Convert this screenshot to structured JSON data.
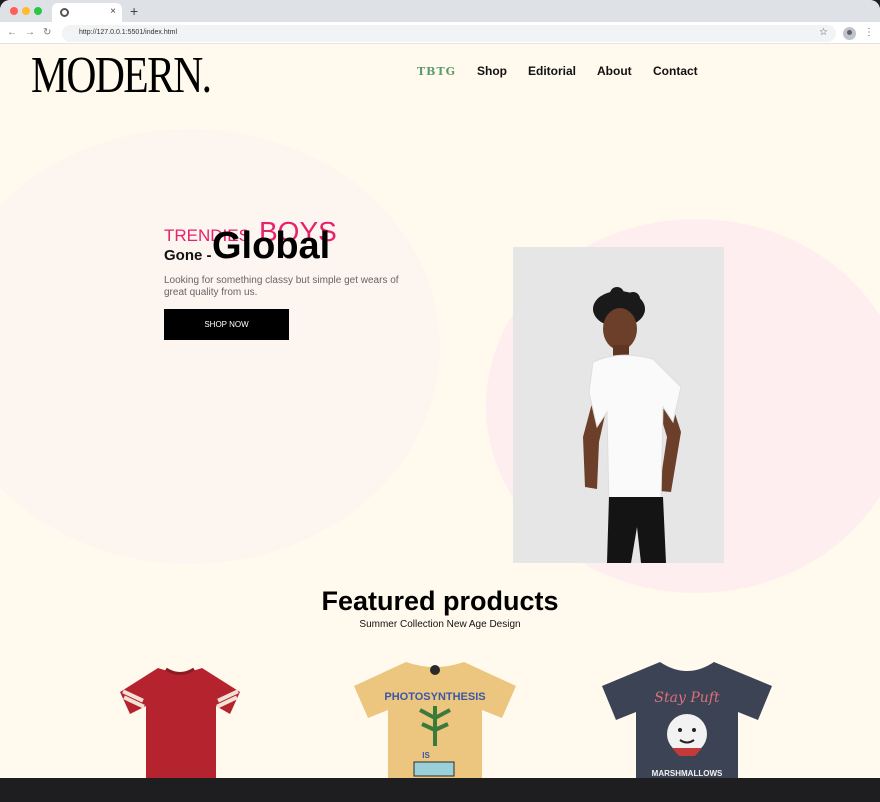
{
  "browser": {
    "tab_title": "",
    "new_tab_label": "+",
    "close_label": "×",
    "url": "http://127.0.0.1:5501/index.html",
    "back": "←",
    "forward": "→",
    "reload": "↻",
    "star": "☆",
    "menu": "⋮"
  },
  "site": {
    "logo": "MODERN.",
    "nav": [
      {
        "label": "TBTG"
      },
      {
        "label": "Shop"
      },
      {
        "label": "Editorial"
      },
      {
        "label": "About"
      },
      {
        "label": "Contact"
      }
    ]
  },
  "hero": {
    "trend": "TRENDIES",
    "boys": "BOYS",
    "gone": "Gone -",
    "global": "Global",
    "description": "Looking for something classy but simple get wears of great quality from us.",
    "cta": "SHOP NOW"
  },
  "featured": {
    "title": "Featured products",
    "subtitle": "Summer Collection New Age Design",
    "products": [
      {
        "color": "#b5232f",
        "name": "red-tshirt"
      },
      {
        "color": "#ecc67e",
        "name": "photosynthesis-tshirt",
        "print": "PHOTOSYNTHESIS",
        "print2": "IS"
      },
      {
        "color": "#3c4355",
        "name": "stay-puft-tshirt",
        "print": "Stay Puft",
        "print2": "MARSHMALLOWS"
      }
    ]
  },
  "colors": {
    "accent_pink": "#e8216d",
    "nav_green": "#5a9b6b",
    "page_bg": "#fffaed",
    "button": "#000000"
  }
}
